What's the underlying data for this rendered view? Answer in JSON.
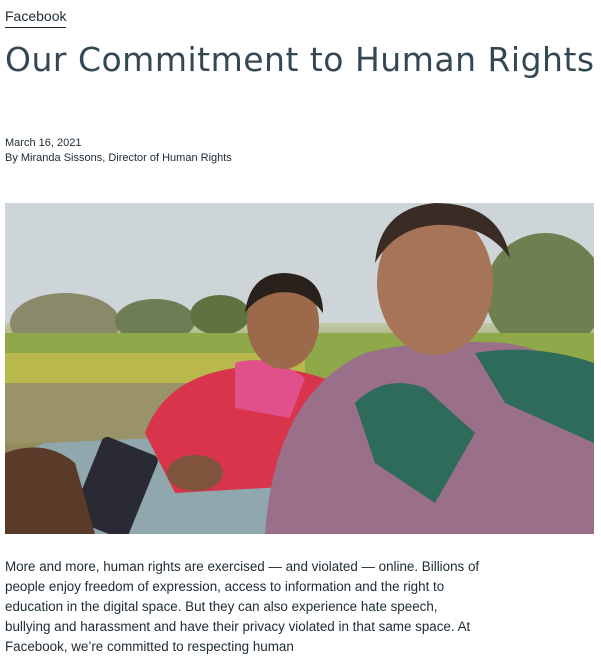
{
  "breadcrumb": {
    "label": "Facebook"
  },
  "article": {
    "title": "Our Commitment to Human Rights",
    "date": "March 16, 2021",
    "byline": "By Miranda Sissons, Director of Human Rights",
    "body": "More and more, human rights are exercised — and violated — online. Billions of people enjoy freedom of expression, access to information and the right to education in the digital space. But they can also experience hate speech, bullying and harassment and have their privacy violated in that same space. At Facebook, we’re committed to respecting human"
  },
  "colors": {
    "text": "#1c2b33",
    "title": "#344854",
    "sky": "#cdd5d8",
    "grass": "#7f9a45"
  }
}
